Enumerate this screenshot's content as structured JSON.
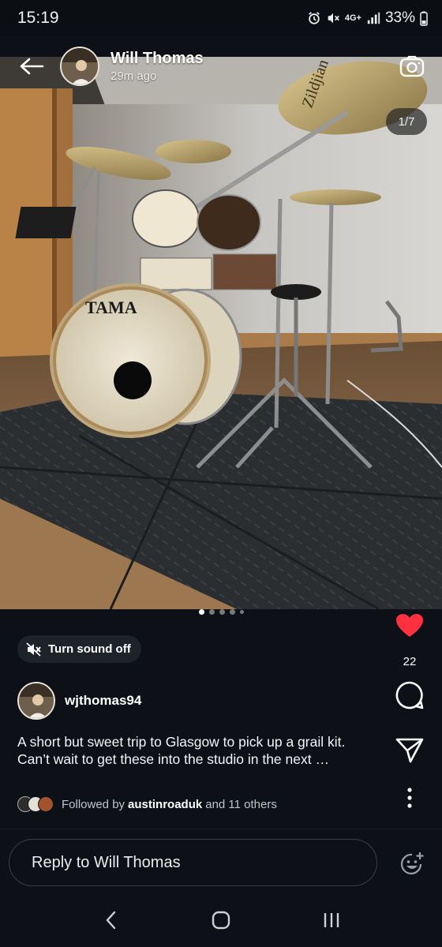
{
  "status_bar": {
    "time": "15:19",
    "network": "4G+",
    "battery": "33%",
    "icons": [
      "alarm-icon",
      "mute-icon",
      "network-icon",
      "signal-icon",
      "battery-icon"
    ]
  },
  "header": {
    "user_name": "Will Thomas",
    "posted_ago": "29m ago",
    "back_icon": "arrow-left-icon",
    "camera_icon": "camera-icon"
  },
  "media": {
    "counter": "1/7",
    "current_index": 1,
    "total": 7,
    "dots": 5,
    "subject": "drum-kit-photo",
    "bass_drum_logo": "TAMA",
    "cymbal_logo": "Zildjian"
  },
  "sound_toggle": {
    "label": "Turn sound off",
    "icon": "speaker-muted-icon"
  },
  "actions": {
    "like_count": "22",
    "like_color": "#ff3040",
    "icons": [
      "heart-icon",
      "comment-icon",
      "share-icon",
      "more-vertical-icon"
    ]
  },
  "author": {
    "username": "wjthomas94"
  },
  "caption": {
    "line1": "A short but sweet trip to Glasgow to pick up a grail kit.",
    "line2": "Can’t wait to get these into the studio in the next …"
  },
  "followed_by": {
    "prefix": "Followed by",
    "user": "austinroaduk",
    "suffix": "and 11 others"
  },
  "reply": {
    "placeholder": "Reply to Will Thomas",
    "emoji_icon": "emoji-add-icon"
  },
  "nav_bar": {
    "buttons": [
      "back-nav-icon",
      "home-nav-icon",
      "recents-nav-icon"
    ]
  },
  "colors": {
    "background": "#0d1117",
    "accent_like": "#ff3040"
  }
}
